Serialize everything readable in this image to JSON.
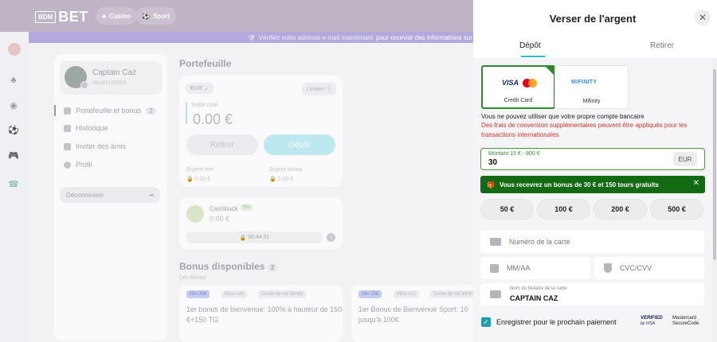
{
  "header": {
    "logo_small": "BDM",
    "logo_big": "BET",
    "nav": [
      {
        "label": "Casino",
        "icon": "casino-icon"
      },
      {
        "label": "Sport",
        "icon": "sport-icon"
      }
    ]
  },
  "notice": {
    "text": "Vérifiez votre adresse e-mail maintenant",
    "link": "pour recevoir des informations sur les bonu"
  },
  "profile": {
    "name": "Captain Caz",
    "id": "Vou91155603",
    "menu": [
      {
        "label": "Portefeuille et bonus",
        "count": "2"
      },
      {
        "label": "Historique"
      },
      {
        "label": "Inviter des amis"
      },
      {
        "label": "Profil"
      }
    ],
    "logout": "Déconnexion"
  },
  "wallet": {
    "title": "Portefeuille",
    "currency": "EUR",
    "limits": "Limites",
    "balance_label": "Solde total",
    "balance": "0.00 €",
    "withdraw": "Retirer",
    "deposit": "Dépôt",
    "real_label": "Argent réel",
    "real_value": "0.00 €",
    "bonus_label": "Argent bonus",
    "bonus_value": "0.00 €"
  },
  "cashback": {
    "title": "Cashback",
    "tag": "0%",
    "amount": "0.00 €",
    "timer": "06:44:51"
  },
  "bonuses": {
    "title": "Bonus disponibles",
    "count": "2",
    "subtitle": "Les Bonus",
    "cards": [
      {
        "tags": [
          "Min 30€",
          "Mise x35",
          "Durée de vie illimité"
        ],
        "text": "1er bonus de bienvenue: 100% à hauteur de 150 €+150 TG"
      },
      {
        "tags": [
          "Min 15€",
          "Mise x12",
          "Durée de vie illimit"
        ],
        "text": "1er Bonus de Bienvenue Sport: 10 jusqu'à 100€"
      }
    ]
  },
  "panel": {
    "title": "Verser de l'argent",
    "tabs": [
      "Dépôt",
      "Retirer"
    ],
    "methods": [
      {
        "label": "Credit Card",
        "logo1": "VISA",
        "selected": true
      },
      {
        "label": "Mifinity",
        "logo1": "MIFINITY"
      }
    ],
    "info": "Vous ne pouvez utiliser que votre propre compte bancaire",
    "warning": "Des frais de conversion supplémentaires peuvent être appliqués pour les transactions internationales",
    "amount_label": "Montant 15 € - 800 €",
    "amount_value": "30",
    "amount_currency": "EUR",
    "bonus_banner": "Vous recevrez un bonus de 30 € et 150 tours gratuits",
    "chips": [
      "50 €",
      "100 €",
      "200 €",
      "500 €"
    ],
    "card_number_placeholder": "Numéro de la carte",
    "expiry_placeholder": "MM/AA",
    "cvc_placeholder": "CVC/CVV",
    "holder_label": "Nom du titulaire de la carte",
    "holder_value": "CAPTAIN CAZ",
    "save_label": "Enregistrer pour le prochain paiement",
    "badge1_line1": "VERIFIED",
    "badge1_line2": "by VISA",
    "badge2_line1": "Mastercard",
    "badge2_line2": "SecureCode"
  },
  "colors": {
    "accent": "#2fb8c9",
    "success": "#126b12",
    "warning": "#d9342b"
  }
}
